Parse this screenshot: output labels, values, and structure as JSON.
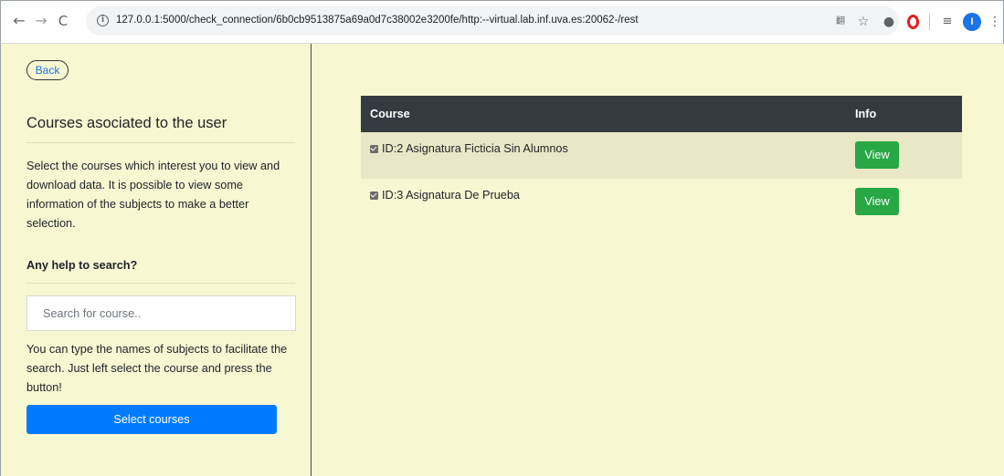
{
  "browser": {
    "nav": {
      "back_icon": "←",
      "forward_icon": "→",
      "reload_icon": "C"
    },
    "url": "127.0.0.1:5000/check_connection/6b0cb9513875a69a0d7c38002e3200fe/http:--virtual.lab.inf.uva.es:20062-/rest",
    "toolbar": {
      "translate_icon": "翻",
      "star_icon": "☆",
      "shield_icon": "●",
      "playlist_icon": "≡",
      "profile_initial": "I",
      "menu_icon": "⋮"
    }
  },
  "sidebar": {
    "back_label": "Back",
    "title": "Courses asociated to the user",
    "description": "Select the courses which interest you to view and download data. It is possible to view some information of the subjects to make a better selection.",
    "help_heading": "Any help to search?",
    "search_placeholder": "Search for course..",
    "search_value": "",
    "search_hint": "You can type the names of subjects to facilitate the search. Just left select the course and press the button!",
    "select_label": "Select courses"
  },
  "table": {
    "headers": {
      "course": "Course",
      "info": "Info"
    },
    "rows": [
      {
        "course": "ID:2 Asignatura Ficticia Sin Alumnos",
        "checked": true,
        "action": "View"
      },
      {
        "course": "ID:3 Asignatura De Prueba",
        "checked": true,
        "action": "View"
      }
    ]
  },
  "colors": {
    "page_background": "#f7f7d2",
    "table_header": "#343a40",
    "primary_button": "#007bff",
    "view_button": "#28a745",
    "link": "#1a73e8"
  }
}
